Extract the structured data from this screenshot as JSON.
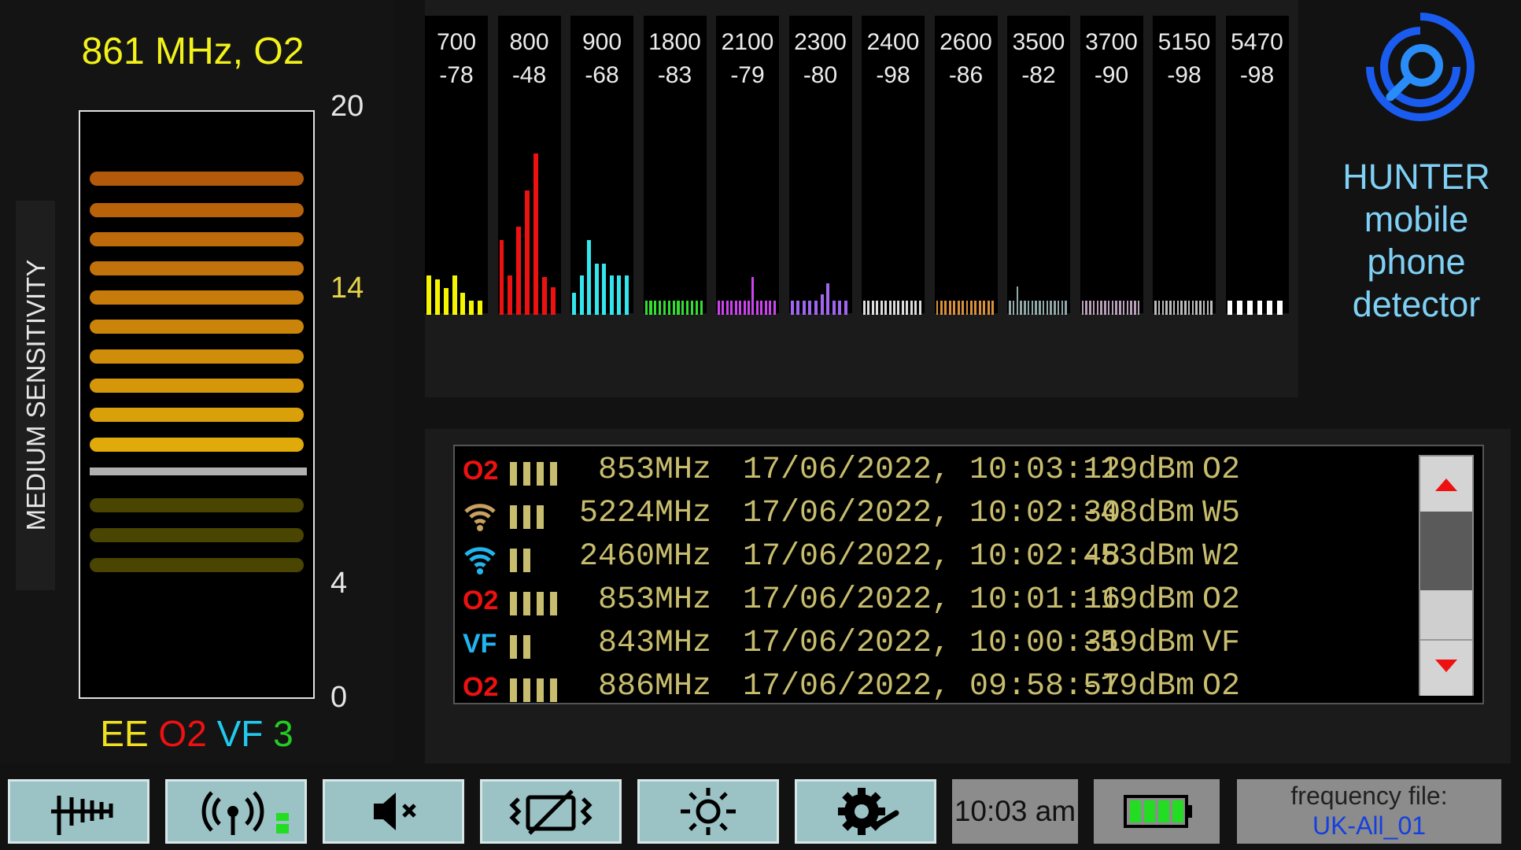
{
  "header": {
    "frequency_title": "861 MHz, O2",
    "sensitivity_label": "MEDIUM SENSITIVITY"
  },
  "meter": {
    "scale_labels": [
      "20",
      "14",
      "4",
      "0"
    ],
    "level": 4,
    "max": 20,
    "threshold": 14,
    "colors": {
      "active": "#e6b800",
      "inactive": "#4a4500",
      "threshold_line": "#b0b0b0"
    }
  },
  "operator_counts": [
    {
      "label": "EE",
      "color": "#f0e020"
    },
    {
      "label": "O2",
      "color": "#ee1111"
    },
    {
      "label": "VF",
      "color": "#22c8ee"
    },
    {
      "label": "3",
      "color": "#22cc22"
    }
  ],
  "spectrum": {
    "bands": [
      {
        "freq": "700",
        "dbm": "-78",
        "color": "#f5f500",
        "bars": [
          50,
          45,
          34,
          50,
          28,
          18,
          18
        ]
      },
      {
        "freq": "800",
        "dbm": "-48",
        "color": "#ee1111",
        "bars": [
          95,
          50,
          112,
          158,
          205,
          48,
          35
        ]
      },
      {
        "freq": "900",
        "dbm": "-68",
        "color": "#33e6ee",
        "bars": [
          28,
          50,
          95,
          65,
          65,
          50,
          50,
          50
        ]
      },
      {
        "freq": "1800",
        "dbm": "-83",
        "color": "#33dd33",
        "bars": [
          18,
          18,
          18,
          18,
          18,
          18,
          18,
          18,
          18,
          18,
          18,
          18,
          18
        ]
      },
      {
        "freq": "2100",
        "dbm": "-79",
        "color": "#cc44ee",
        "bars": [
          18,
          18,
          18,
          18,
          18,
          18,
          18,
          18,
          48,
          18,
          18,
          18,
          18,
          18
        ]
      },
      {
        "freq": "2300",
        "dbm": "-80",
        "color": "#a066ee",
        "bars": [
          18,
          18,
          18,
          18,
          18,
          26,
          40,
          18,
          18,
          18
        ]
      },
      {
        "freq": "2400",
        "dbm": "-98",
        "color": "#dddddd",
        "bars": [
          18,
          18,
          18,
          18,
          18,
          18,
          18,
          18,
          18,
          18,
          18,
          18,
          18,
          18
        ]
      },
      {
        "freq": "2600",
        "dbm": "-86",
        "color": "#d9903a",
        "bars": [
          18,
          18,
          18,
          18,
          18,
          18,
          18,
          18,
          18,
          18,
          18,
          18,
          18,
          18
        ]
      },
      {
        "freq": "3500",
        "dbm": "-82",
        "color": "#90a8a8",
        "bars": [
          18,
          18,
          36,
          18,
          18,
          18,
          18,
          18,
          18,
          18,
          18,
          18,
          18,
          18,
          18,
          18
        ]
      },
      {
        "freq": "3700",
        "dbm": "-90",
        "color": "#b8a0b8",
        "bars": [
          18,
          18,
          18,
          18,
          18,
          18,
          18,
          18,
          18,
          18,
          18,
          18,
          18,
          18,
          18,
          18
        ]
      },
      {
        "freq": "5150",
        "dbm": "-98",
        "color": "#bbbbbb",
        "bars": [
          18,
          18,
          18,
          18,
          18,
          18,
          18,
          18,
          18,
          18,
          18,
          18,
          18,
          18,
          18,
          18
        ]
      },
      {
        "freq": "5470",
        "dbm": "-98",
        "color": "#ffffff",
        "bars": [
          18,
          18,
          18,
          18,
          18,
          18
        ]
      }
    ]
  },
  "brand": {
    "line1": "HUNTER",
    "line2": "mobile",
    "line3": "phone",
    "line4": "detector",
    "logo_icon": "search-signal-icon",
    "colors": {
      "text": "#7fd0f5",
      "logo": "#1a5cf0"
    }
  },
  "log": {
    "rows": [
      {
        "op": "O2",
        "op_type": "text",
        "op_color": "#ee1111",
        "bars": 4,
        "freq": "853MHz",
        "datetime": "17/06/2022, 10:03:12",
        "dbm": "-19dBm",
        "code": "O2"
      },
      {
        "op": "",
        "op_type": "wifi",
        "op_color": "#c8a060",
        "bars": 3,
        "freq": "5224MHz",
        "datetime": "17/06/2022, 10:02:30",
        "dbm": "-48dBm",
        "code": "W5"
      },
      {
        "op": "",
        "op_type": "wifi",
        "op_color": "#22b4ee",
        "bars": 2,
        "freq": "2460MHz",
        "datetime": "17/06/2022, 10:02:48",
        "dbm": "-53dBm",
        "code": "W2"
      },
      {
        "op": "O2",
        "op_type": "text",
        "op_color": "#ee1111",
        "bars": 4,
        "freq": "853MHz",
        "datetime": "17/06/2022, 10:01:16",
        "dbm": "-19dBm",
        "code": "O2"
      },
      {
        "op": "VF",
        "op_type": "text",
        "op_color": "#22b4ee",
        "bars": 2,
        "freq": "843MHz",
        "datetime": "17/06/2022, 10:00:31",
        "dbm": "-59dBm",
        "code": "VF"
      },
      {
        "op": "O2",
        "op_type": "text",
        "op_color": "#ee1111",
        "bars": 4,
        "freq": "886MHz",
        "datetime": "17/06/2022, 09:58:57",
        "dbm": "-19dBm",
        "code": "O2"
      }
    ]
  },
  "toolbar": {
    "buttons": [
      {
        "name": "antenna-button",
        "icon": "yagi-antenna-icon"
      },
      {
        "name": "signal-button",
        "icon": "broadcast-signal-icon"
      },
      {
        "name": "mute-button",
        "icon": "speaker-mute-icon"
      },
      {
        "name": "vibrate-off-button",
        "icon": "vibrate-off-icon"
      },
      {
        "name": "brightness-button",
        "icon": "sun-icon"
      },
      {
        "name": "settings-button",
        "icon": "gear-wrench-icon"
      }
    ],
    "time": "10:03 am",
    "battery_icon": "battery-full-icon",
    "battery_level": 1.0,
    "frequency_file_label": "frequency file:",
    "frequency_file_value": "UK-All_01"
  }
}
